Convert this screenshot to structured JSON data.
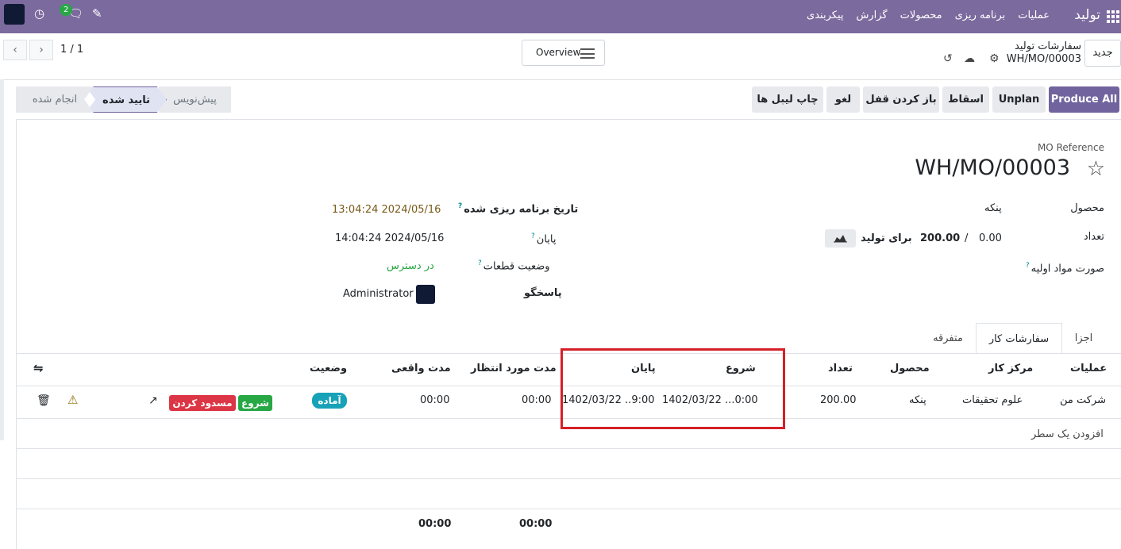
{
  "topbar": {
    "brand": "تولید",
    "menu": [
      "عملیات",
      "برنامه ریزی",
      "محصولات",
      "گزارش",
      "پیکربندی"
    ],
    "chat_badge": "2"
  },
  "control": {
    "pager": "1 / 1",
    "overview_label": "Overview",
    "new_label": "جدید",
    "breadcrumb_parent": "سفارشات تولید",
    "breadcrumb_current": "WH/MO/00003"
  },
  "actions": {
    "produce_all": "Produce All",
    "unplan": "Unplan",
    "scrap": "اسقاط",
    "unlock": "باز کردن قفل",
    "cancel": "لغو",
    "print_labels": "چاپ لیبل ها"
  },
  "status": {
    "draft": "پیش‌نویس",
    "confirmed": "تایید شده",
    "done": "انجام شده"
  },
  "form": {
    "ref_label": "MO Reference",
    "ref": "WH/MO/00003",
    "product_label": "محصول",
    "product": "پنکه",
    "qty_label": "تعداد",
    "qty_produced": "0.00",
    "qty_sep": "/",
    "qty_total": "200.00",
    "qty_unit": "برای تولید",
    "bom_label": "صورت مواد اولیه",
    "scheduled_label": "تاریخ برنامه ریزی شده",
    "scheduled_value": "13:04:24 2024/05/16",
    "end_label": "پایان",
    "end_value": "14:04:24 2024/05/16",
    "components_label": "وضعیت قطعات",
    "components_value": "در دسترس",
    "responsible_label": "پاسخگو",
    "responsible_value": "Administrator"
  },
  "tabs": [
    "اجزا",
    "سفارشات کار",
    "متفرقه"
  ],
  "table": {
    "headers": {
      "operation": "عملیات",
      "workcenter": "مرکز کار",
      "product": "محصول",
      "qty": "تعداد",
      "start": "شروع",
      "end": "پایان",
      "expected": "مدت مورد انتظار",
      "real": "مدت واقعی",
      "state": "وضعیت"
    },
    "row": {
      "operation": "شرکت من",
      "workcenter": "علوم تحقیقات",
      "product": "پنکه",
      "qty": "200.00",
      "start": "1402/03/22 ...0:00",
      "end": "1402/03/22 ..9:00",
      "expected": "00:00",
      "real": "00:00",
      "state": "آماده",
      "start_btn": "شروع",
      "block_btn": "مسدود کردن"
    },
    "add_line": "افزودن یک سطر",
    "total_expected": "00:00",
    "total_real": "00:00"
  },
  "colors": {
    "topbar": "#7b6a9e",
    "primary": "#71639e",
    "highlight": "#d52027"
  }
}
